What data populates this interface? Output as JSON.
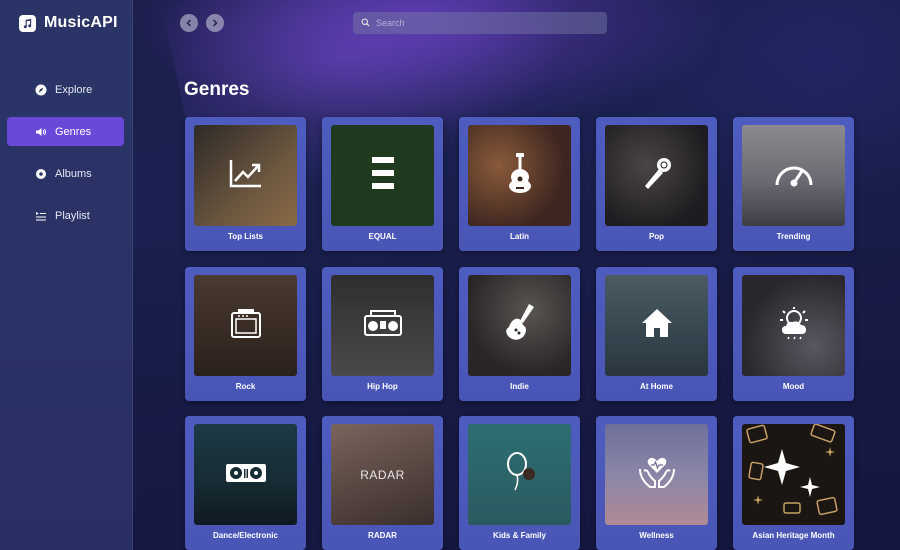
{
  "app": {
    "title": "MusicAPI"
  },
  "sidebar": {
    "items": [
      {
        "label": "Explore",
        "icon": "compass-icon",
        "active": false
      },
      {
        "label": "Genres",
        "icon": "speaker-icon",
        "active": true
      },
      {
        "label": "Albums",
        "icon": "disc-icon",
        "active": false
      },
      {
        "label": "Playlist",
        "icon": "playlist-icon",
        "active": false
      }
    ]
  },
  "topbar": {
    "back_icon": "chevron-left-icon",
    "forward_icon": "chevron-right-icon",
    "search_placeholder": "Search"
  },
  "page": {
    "title": "Genres"
  },
  "genres": [
    {
      "label": "Top Lists",
      "icon": "chart-up-icon",
      "bg": "#5b4a3a"
    },
    {
      "label": "EQUAL",
      "icon": "equal-bars-icon",
      "bg": "#1f3a1f"
    },
    {
      "label": "Latin",
      "icon": "guitar-icon",
      "bg": "#5a3b2f"
    },
    {
      "label": "Pop",
      "icon": "microphone-icon",
      "bg": "#2c2a2f"
    },
    {
      "label": "Trending",
      "icon": "gauge-icon",
      "bg": "#7a7a80"
    },
    {
      "label": "Rock",
      "icon": "amplifier-icon",
      "bg": "#3b2f28"
    },
    {
      "label": "Hip Hop",
      "icon": "boombox-icon",
      "bg": "#3a3a3d"
    },
    {
      "label": "Indie",
      "icon": "electric-guitar-icon",
      "bg": "#3d3a3a"
    },
    {
      "label": "At Home",
      "icon": "house-icon",
      "bg": "#3a4a55"
    },
    {
      "label": "Mood",
      "icon": "cloud-sun-icon",
      "bg": "#3f3f44"
    },
    {
      "label": "Dance/Electronic",
      "icon": "turntable-icon",
      "bg": "#1f3640"
    },
    {
      "label": "RADAR",
      "icon": "radar-text-icon",
      "bg": "#5d4a45",
      "art_text": "RADAR"
    },
    {
      "label": "Kids & Family",
      "icon": "balloon-icon",
      "bg": "#2e6a6e"
    },
    {
      "label": "Wellness",
      "icon": "heart-hands-icon",
      "bg": "#7e7ea6"
    },
    {
      "label": "Asian Heritage Month",
      "icon": "sparkle-icon",
      "bg": "#1b1612"
    }
  ]
}
